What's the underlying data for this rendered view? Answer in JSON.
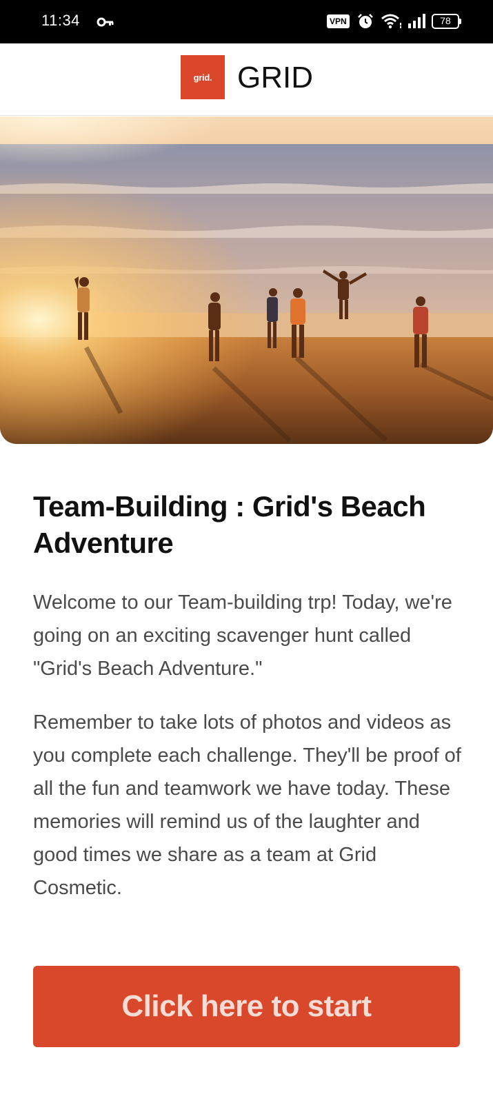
{
  "status_bar": {
    "time": "11:34",
    "vpn_label": "VPN",
    "battery_level": "78",
    "icons": [
      "key-icon",
      "alarm-icon",
      "wifi-icon",
      "signal-icon",
      "battery-icon"
    ]
  },
  "header": {
    "logo_text": "grid.",
    "brand": "GRID"
  },
  "hero": {
    "icon": "beach-photo"
  },
  "content": {
    "title": "Team-Building : Grid's Beach Adventure",
    "paragraph_1": "Welcome to our Team-building trp! Today, we're going on an exciting scavenger hunt called \"Grid's Beach Adventure.\"",
    "paragraph_2": "Remember to take lots of photos and videos as you complete each challenge. They'll be proof of all the fun and teamwork we have today. These memories will remind us of the laughter and good times we share as a team at Grid Cosmetic."
  },
  "cta": {
    "label": "Click here to start"
  },
  "colors": {
    "accent": "#d9482b",
    "text_primary": "#111111",
    "text_body": "#4a4a4a"
  }
}
